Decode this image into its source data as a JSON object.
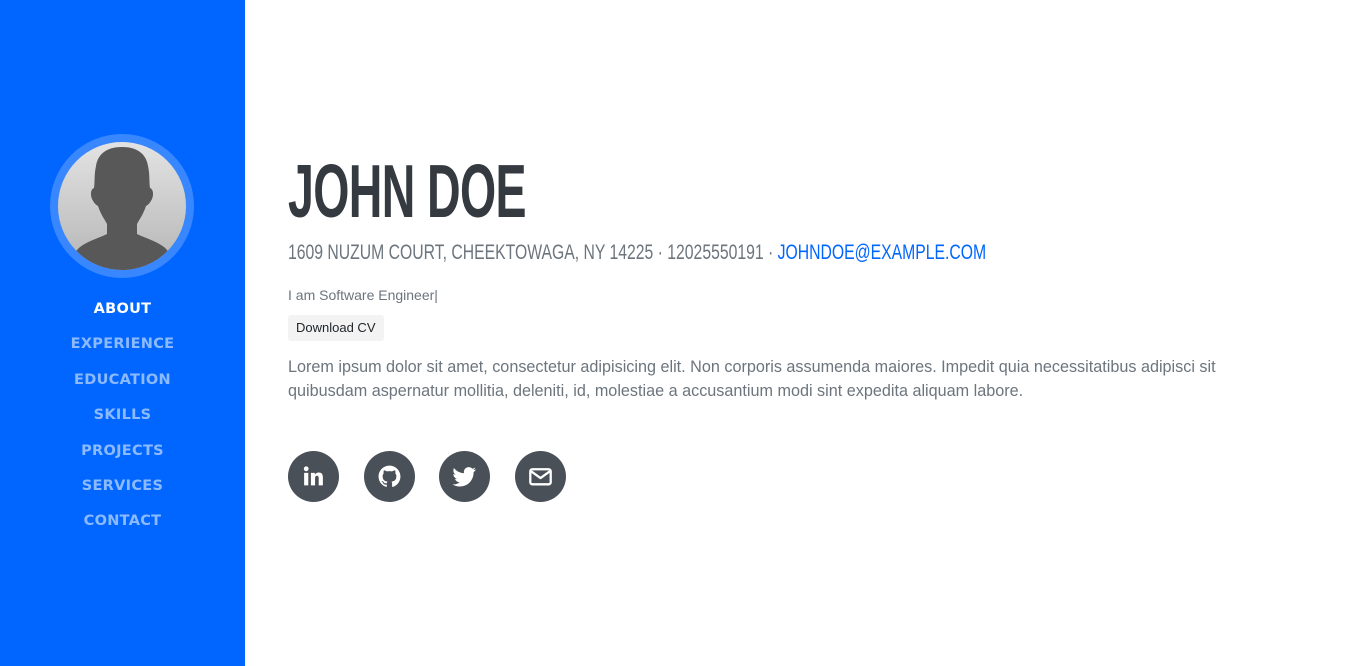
{
  "profile": {
    "first_name": "JOHN",
    "last_name": "DOE",
    "name": "JOHN DOE",
    "address": "1609 NUZUM COURT, CHEEKTOWAGA, NY 14225 · 12025550191 · ",
    "email": "JOHNDOE@EXAMPLE.COM",
    "role": "I am Software Engineer|",
    "download_label": "Download CV",
    "bio": "Lorem ipsum dolor sit amet, consectetur adipisicing elit. Non corporis assumenda maiores. Impedit quia necessitatibus adipisci sit quibusdam aspernatur mollitia, deleniti, id, molestiae a accusantium modi sint expedita aliquam labore."
  },
  "sidebar": {
    "avatar_icon": "user-silhouette-icon",
    "nav": [
      {
        "label": "ABOUT",
        "active": true
      },
      {
        "label": "EXPERIENCE",
        "active": false
      },
      {
        "label": "EDUCATION",
        "active": false
      },
      {
        "label": "SKILLS",
        "active": false
      },
      {
        "label": "PROJECTS",
        "active": false
      },
      {
        "label": "SERVICES",
        "active": false
      },
      {
        "label": "CONTACT",
        "active": false
      }
    ]
  },
  "socials": [
    {
      "name": "linkedin",
      "icon": "linkedin-icon"
    },
    {
      "name": "github",
      "icon": "github-icon"
    },
    {
      "name": "twitter",
      "icon": "twitter-icon"
    },
    {
      "name": "email",
      "icon": "envelope-icon"
    }
  ],
  "colors": {
    "sidebar_bg": "#0066ff",
    "heading": "#343a40",
    "text_muted": "#6c757d",
    "link": "#0066ff",
    "social_bg": "#495057"
  }
}
